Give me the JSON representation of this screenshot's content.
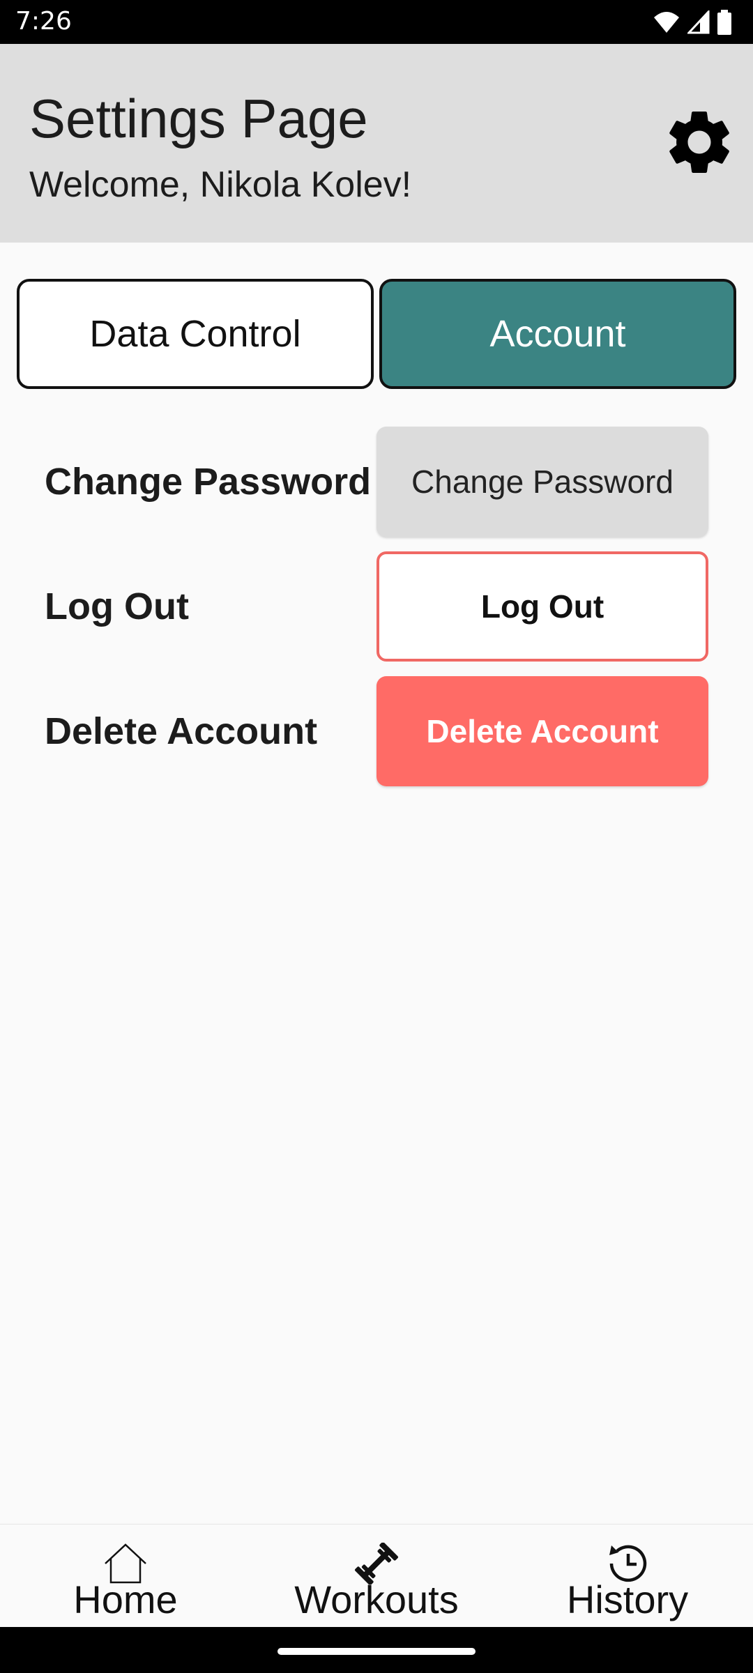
{
  "status_bar": {
    "time": "7:26"
  },
  "header": {
    "title": "Settings Page",
    "welcome": "Welcome, Nikola Kolev!"
  },
  "tabs": [
    {
      "label": "Data Control",
      "active": false
    },
    {
      "label": "Account",
      "active": true
    }
  ],
  "account": {
    "change_password": {
      "label": "Change Password",
      "button": "Change Password"
    },
    "log_out": {
      "label": "Log Out",
      "button": "Log Out"
    },
    "delete_account": {
      "label": "Delete Account",
      "button": "Delete Account"
    }
  },
  "bottom_nav": {
    "items": [
      {
        "label": "Home",
        "icon": "home-icon"
      },
      {
        "label": "Workouts",
        "icon": "dumbbell-icon"
      },
      {
        "label": "History",
        "icon": "history-icon"
      }
    ]
  },
  "colors": {
    "accent_teal": "#3b8483",
    "danger_red": "#ff6b66",
    "header_bg": "#dedede"
  }
}
